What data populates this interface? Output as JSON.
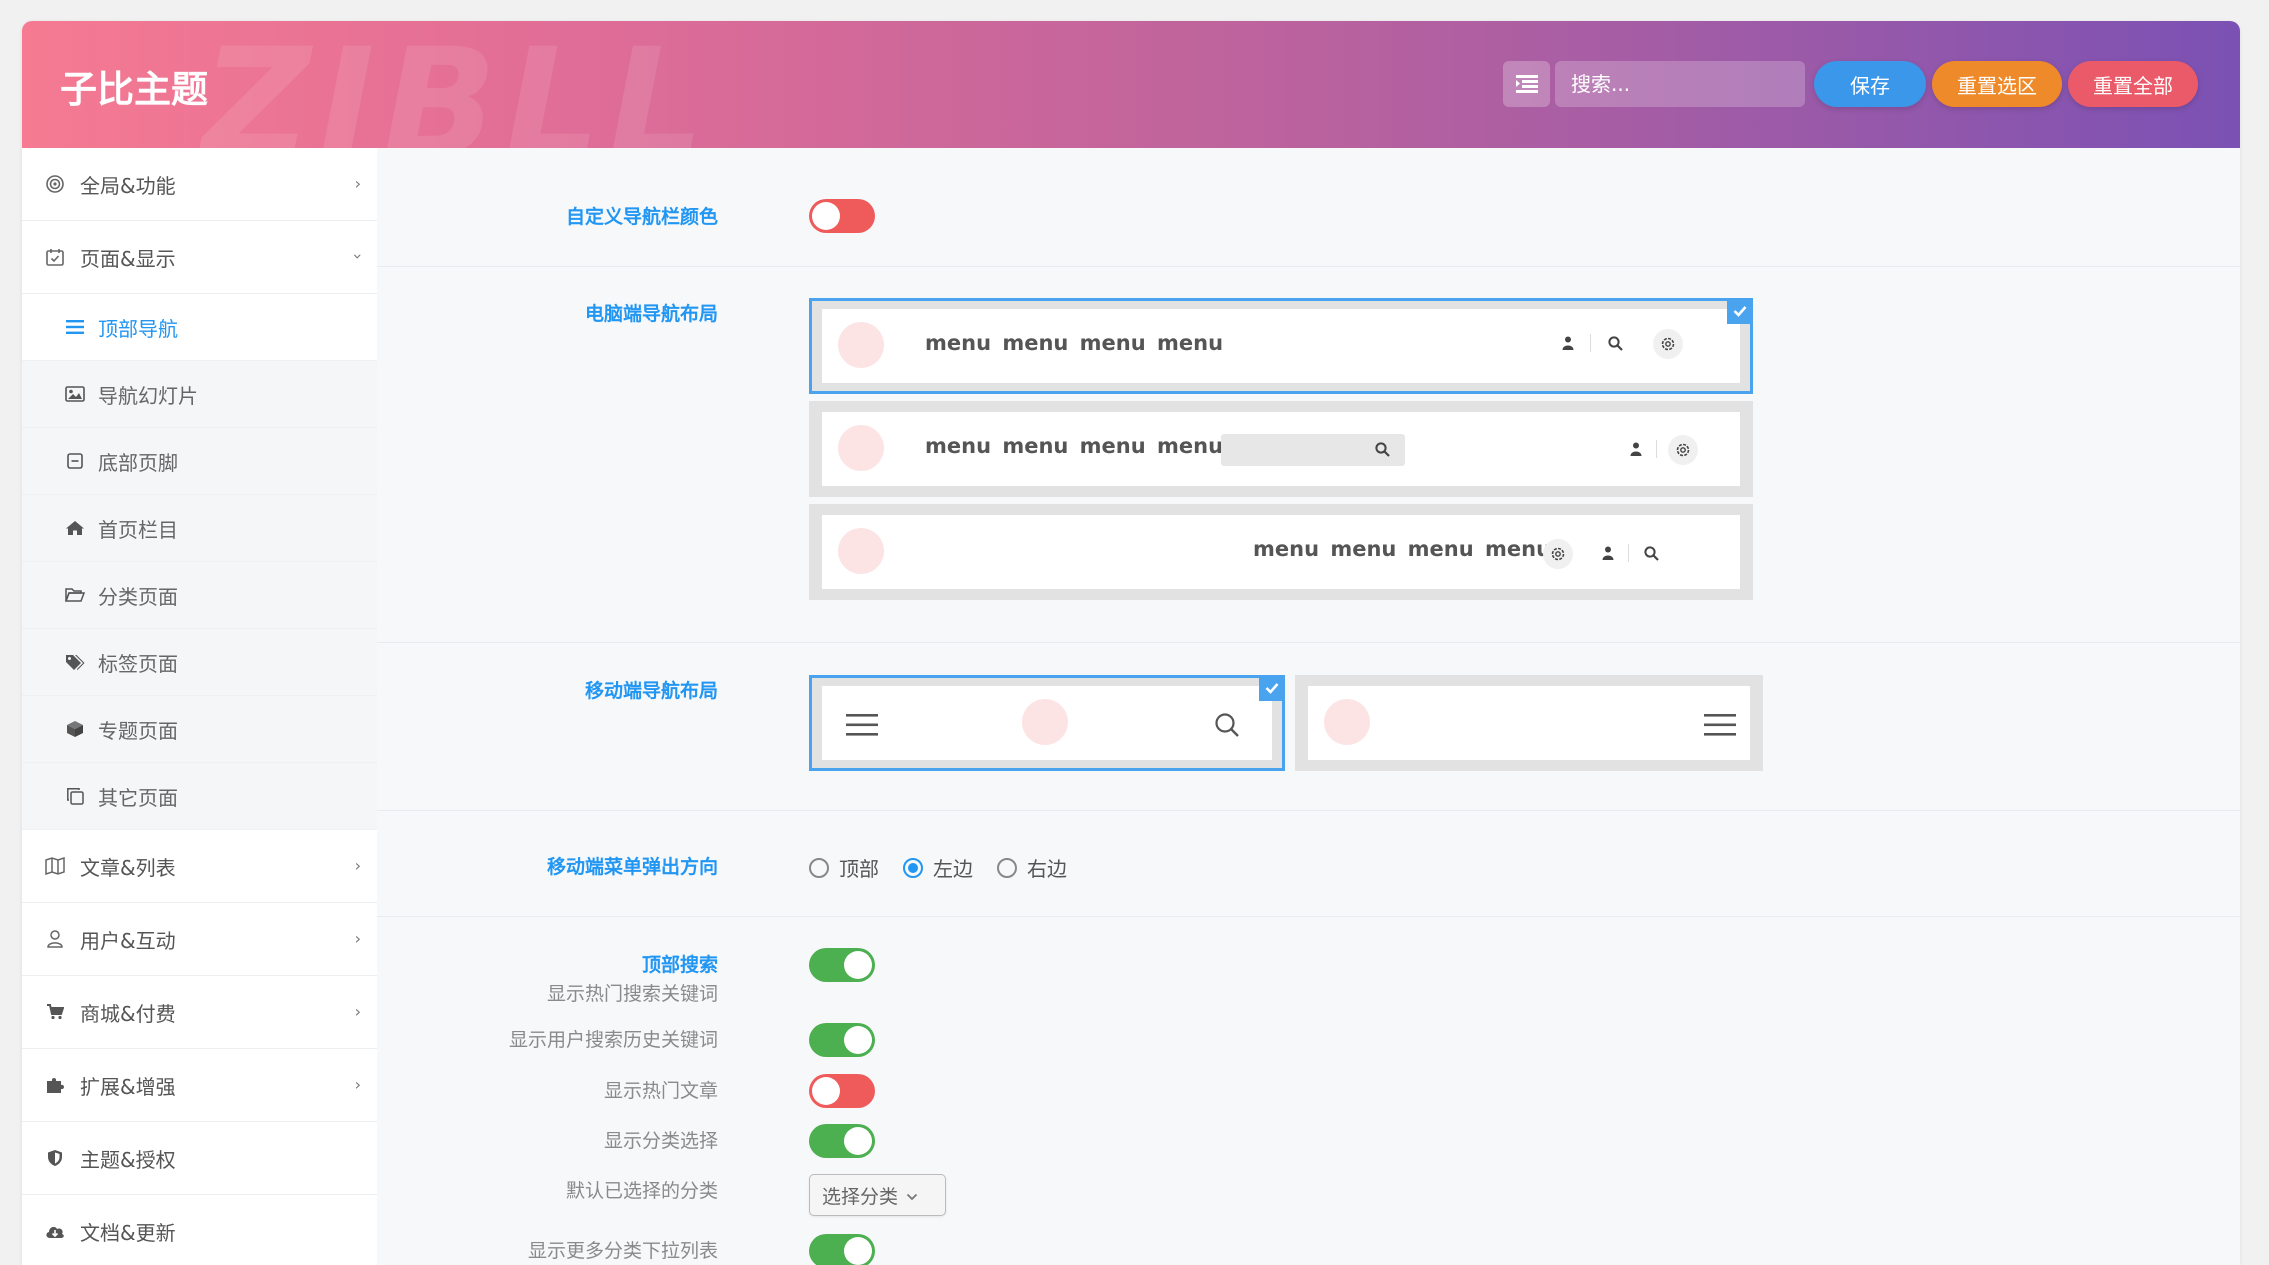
{
  "header": {
    "title": "子比主题",
    "watermark": "ZIBLL",
    "search_placeholder": "搜索...",
    "buttons": {
      "save": "保存",
      "reset_section": "重置选区",
      "reset_all": "重置全部"
    },
    "colors": {
      "save": "#3b97ea",
      "reset_section": "#ef8a2b",
      "reset_all": "#ea5a68"
    }
  },
  "sidebar": {
    "items": [
      {
        "label": "全局&功能",
        "icon": "bullseye-icon"
      },
      {
        "label": "页面&显示",
        "icon": "calendar-check-icon"
      }
    ],
    "sub_items": [
      {
        "label": "顶部导航",
        "icon": "bars-icon",
        "active": true
      },
      {
        "label": "导航幻灯片",
        "icon": "image-icon"
      },
      {
        "label": "底部页脚",
        "icon": "window-minimize-icon"
      },
      {
        "label": "首页栏目",
        "icon": "home-icon"
      },
      {
        "label": "分类页面",
        "icon": "folder-open-icon"
      },
      {
        "label": "标签页面",
        "icon": "tags-icon"
      },
      {
        "label": "专题页面",
        "icon": "cube-icon"
      },
      {
        "label": "其它页面",
        "icon": "copy-icon"
      }
    ],
    "items_after": [
      {
        "label": "文章&列表",
        "icon": "map-icon"
      },
      {
        "label": "用户&互动",
        "icon": "user-icon"
      },
      {
        "label": "商城&付费",
        "icon": "cart-icon"
      },
      {
        "label": "扩展&增强",
        "icon": "puzzle-icon"
      },
      {
        "label": "主题&授权",
        "icon": "shield-icon"
      },
      {
        "label": "文档&更新",
        "icon": "cloud-download-icon"
      }
    ]
  },
  "main": {
    "custom_nav_color": {
      "label": "自定义导航栏颜色",
      "on": false
    },
    "desktop_layout": {
      "label": "电脑端导航布局",
      "menu_text": "menu  menu  menu  menu",
      "selected": 0
    },
    "mobile_layout": {
      "label": "移动端导航布局",
      "selected": 0
    },
    "mobile_menu_direction": {
      "label": "移动端菜单弹出方向",
      "options": [
        "顶部",
        "左边",
        "右边"
      ],
      "selected": 1
    },
    "top_search": {
      "label": "顶部搜索",
      "sublabel": "显示热门搜索关键词",
      "rows": [
        {
          "label": "显示用户搜索历史关键词",
          "on": true
        },
        {
          "label": "显示热门文章",
          "on": false
        },
        {
          "label": "显示分类选择",
          "on": true
        },
        {
          "label": "默认已选择的分类",
          "select": "选择分类"
        },
        {
          "label": "显示更多分类下拉列表",
          "on": true
        }
      ],
      "on": true
    },
    "colors": {
      "accent": "#2196f3",
      "toggle_on": "#4caf50",
      "toggle_off": "#ef5b5b"
    }
  }
}
